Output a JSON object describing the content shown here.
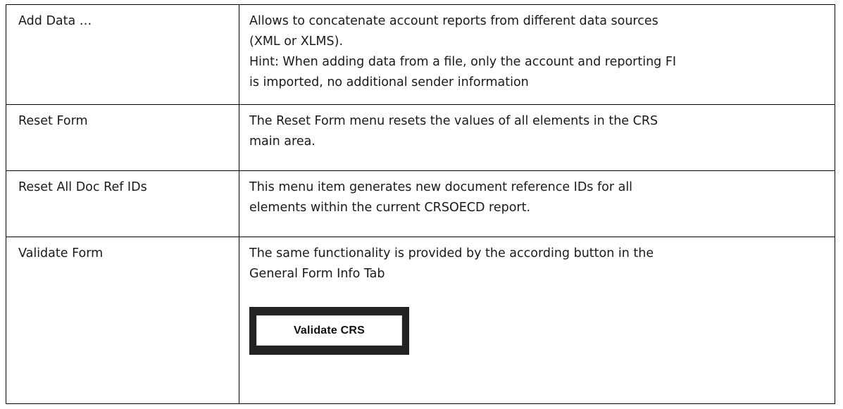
{
  "table": {
    "rows": [
      {
        "term": "Add Data …",
        "desc_lines": [
          "Allows to concatenate account reports from different data sources",
          "(XML or XLMS).",
          "Hint: When adding data from a file, only the account and reporting FI",
          "is imported, no additional sender information"
        ]
      },
      {
        "term": "Reset Form",
        "desc_lines": [
          "The Reset Form menu resets the values of all elements in the CRS",
          "main area."
        ]
      },
      {
        "term": "Reset All Doc Ref IDs",
        "desc_lines": [
          "This menu item generates new document reference IDs for all",
          "elements within the current CRSOECD report."
        ]
      },
      {
        "term": "Validate Form",
        "desc_lines": [
          "The same functionality is provided by the according button in the",
          "General Form Info Tab"
        ],
        "button_label": "Validate CRS"
      }
    ]
  }
}
